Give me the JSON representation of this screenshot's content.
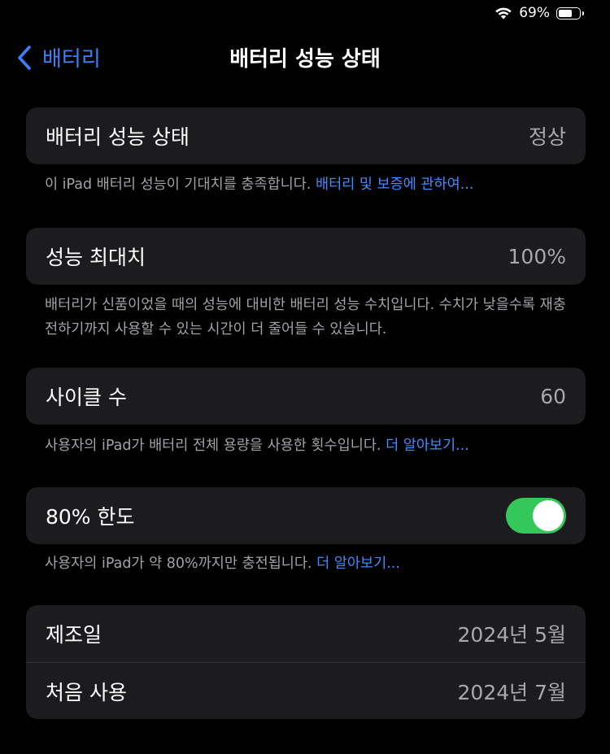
{
  "status_bar": {
    "battery_percent": "69%",
    "battery_level": 0.69,
    "wifi_icon": "wifi-icon"
  },
  "nav": {
    "back_label": "배터리",
    "title": "배터리 성능 상태"
  },
  "health": {
    "label": "배터리 성능 상태",
    "value": "정상",
    "footnote": "이 iPad 배터리 성능이 기대치를 충족합니다. ",
    "footnote_link": "배터리 및 보증에 관하여..."
  },
  "max_capacity": {
    "label": "성능 최대치",
    "value": "100%",
    "footnote": "배터리가 신품이었을 때의 성능에 대비한 배터리 성능 수치입니다. 수치가 낮을수록 재충전하기까지 사용할 수 있는 시간이 더 줄어들 수 있습니다."
  },
  "cycle_count": {
    "label": "사이클 수",
    "value": "60",
    "footnote": "사용자의 iPad가 배터리 전체 용량을 사용한 횟수입니다. ",
    "footnote_link": "더 알아보기..."
  },
  "limit80": {
    "label": "80% 한도",
    "toggle_on": true,
    "footnote": "사용자의 iPad가 약 80%까지만 충전됩니다. ",
    "footnote_link": "더 알아보기..."
  },
  "dates": {
    "manufactured_label": "제조일",
    "manufactured_value": "2024년 5월",
    "first_use_label": "처음 사용",
    "first_use_value": "2024년 7월"
  },
  "colors": {
    "accent": "#3f8cff",
    "toggle_on": "#34c759",
    "cell_bg": "#1c1c1e"
  }
}
